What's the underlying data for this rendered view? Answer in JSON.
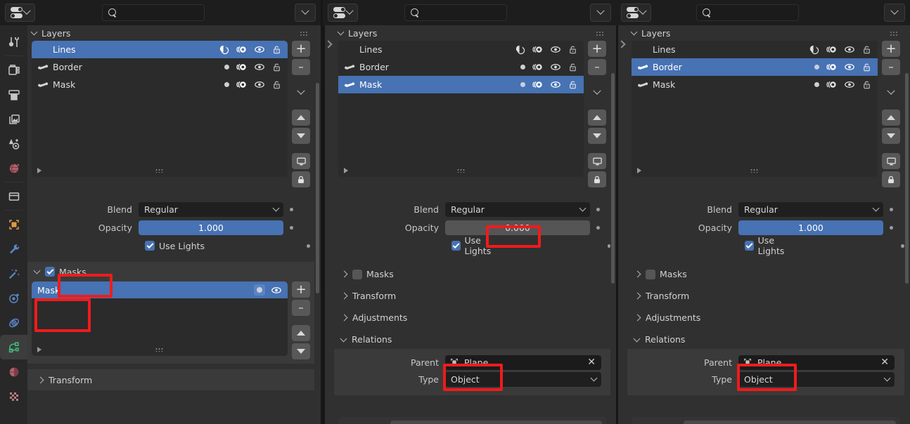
{
  "app": "Blender Properties Editor — Grease Pencil Layers",
  "header": {
    "editor_type_icon": "properties-editor-icon",
    "search_placeholder": "",
    "options_icon": "chevron-down-icon"
  },
  "sidebar_tabs": [
    {
      "name": "tool",
      "icon": "tool-icon",
      "selected": false
    },
    {
      "name": "render",
      "icon": "render-camera-icon",
      "selected": false
    },
    {
      "name": "output",
      "icon": "printer-output-icon",
      "selected": false
    },
    {
      "name": "view-layer",
      "icon": "images-viewlayer-icon",
      "selected": false
    },
    {
      "name": "scene",
      "icon": "scene-cone-droplet-icon",
      "selected": false
    },
    {
      "name": "world",
      "icon": "world-globe-icon",
      "selected": false
    },
    {
      "name": "collection",
      "icon": "collection-box-icon",
      "selected": false
    },
    {
      "name": "object",
      "icon": "object-square-icon",
      "selected": false
    },
    {
      "name": "modifiers",
      "icon": "wrench-icon",
      "selected": false
    },
    {
      "name": "effects",
      "icon": "magic-wand-icon",
      "selected": false
    },
    {
      "name": "particles",
      "icon": "particles-icon",
      "selected": false
    },
    {
      "name": "physics",
      "icon": "physics-orbit-icon",
      "selected": false
    },
    {
      "name": "object-data",
      "icon": "grease-pencil-data-icon",
      "selected": true
    },
    {
      "name": "material",
      "icon": "material-sphere-icon",
      "selected": false
    },
    {
      "name": "texture",
      "icon": "texture-checker-icon",
      "selected": false
    }
  ],
  "panels": [
    {
      "id": "panel-1",
      "layers_header": "Layers",
      "layers": [
        {
          "name": "Lines",
          "has_bone": false,
          "selected": true,
          "mask_dot": "filled-circle-icon",
          "onion": "onion-skin-icon",
          "visible": "eye-icon",
          "lock": "unlocked-icon"
        },
        {
          "name": "Border",
          "has_bone": true,
          "selected": false,
          "mask_dot": "dot-icon",
          "onion": "onion-skin-icon",
          "visible": "eye-icon",
          "lock": "unlocked-icon"
        },
        {
          "name": "Mask",
          "has_bone": true,
          "selected": false,
          "mask_dot": "dot-icon",
          "onion": "onion-skin-icon",
          "visible": "eye-icon",
          "lock": "unlocked-icon"
        }
      ],
      "list_buttons": [
        "add-icon",
        "remove-icon",
        "dropdown-icon",
        "move-up-icon",
        "move-down-icon",
        "isolate-display-icon",
        "lock-icon"
      ],
      "blend_label": "Blend",
      "blend_value": "Regular",
      "opacity_label": "Opacity",
      "opacity_value": "1.000",
      "opacity_filled": true,
      "use_lights_label": "Use Lights",
      "use_lights_checked": true,
      "masks_label": "Masks",
      "masks_checked": true,
      "masks_expanded": true,
      "mask_items": [
        {
          "name": "Mask",
          "selected": true,
          "invert": "invert-circle-icon",
          "visible": "eye-icon"
        }
      ],
      "transform_label": "Transform",
      "transform_expanded": false,
      "sections": [],
      "has_relations": false
    },
    {
      "id": "panel-2",
      "layers_header": "Layers",
      "layers": [
        {
          "name": "Lines",
          "has_bone": false,
          "selected": false,
          "mask_dot": "filled-circle-icon",
          "onion": "onion-skin-icon",
          "visible": "eye-icon",
          "lock": "unlocked-icon"
        },
        {
          "name": "Border",
          "has_bone": true,
          "selected": false,
          "mask_dot": "dot-icon",
          "onion": "onion-skin-icon",
          "visible": "eye-icon",
          "lock": "unlocked-icon"
        },
        {
          "name": "Mask",
          "has_bone": true,
          "selected": true,
          "mask_dot": "dot-icon",
          "onion": "onion-skin-icon",
          "visible": "eye-icon",
          "lock": "unlocked-icon"
        }
      ],
      "blend_label": "Blend",
      "blend_value": "Regular",
      "opacity_label": "Opacity",
      "opacity_value": "0.000",
      "opacity_filled": false,
      "use_lights_label": "Use Lights",
      "use_lights_checked": true,
      "masks_label": "Masks",
      "masks_checked": false,
      "masks_expanded": false,
      "sections": [
        {
          "label": "Transform",
          "expanded": false
        },
        {
          "label": "Adjustments",
          "expanded": false
        },
        {
          "label": "Relations",
          "expanded": true
        }
      ],
      "has_relations": true,
      "parent_label": "Parent",
      "parent_value": "Plane",
      "parent_icon": "object-plane-icon",
      "parent_clear_icon": "x-close-icon",
      "type_label": "Type",
      "type_value": "Object"
    },
    {
      "id": "panel-3",
      "layers_header": "Layers",
      "layers": [
        {
          "name": "Lines",
          "has_bone": false,
          "selected": false,
          "mask_dot": "filled-circle-icon",
          "onion": "onion-skin-icon",
          "visible": "eye-icon",
          "lock": "unlocked-icon"
        },
        {
          "name": "Border",
          "has_bone": true,
          "selected": true,
          "mask_dot": "dot-icon",
          "onion": "onion-skin-icon",
          "visible": "eye-icon",
          "lock": "unlocked-icon"
        },
        {
          "name": "Mask",
          "has_bone": true,
          "selected": false,
          "mask_dot": "dot-icon",
          "onion": "onion-skin-icon",
          "visible": "eye-icon",
          "lock": "unlocked-icon"
        }
      ],
      "blend_label": "Blend",
      "blend_value": "Regular",
      "opacity_label": "Opacity",
      "opacity_value": "1.000",
      "opacity_filled": true,
      "use_lights_label": "Use Lights",
      "use_lights_checked": true,
      "masks_label": "Masks",
      "masks_checked": false,
      "masks_expanded": false,
      "sections": [
        {
          "label": "Transform",
          "expanded": false
        },
        {
          "label": "Adjustments",
          "expanded": false
        },
        {
          "label": "Relations",
          "expanded": true
        }
      ],
      "has_relations": true,
      "parent_label": "Parent",
      "parent_value": "Plane",
      "parent_icon": "object-plane-icon",
      "parent_clear_icon": "x-close-icon",
      "type_label": "Type",
      "type_value": "Object"
    }
  ],
  "colors": {
    "accent_blue": "#4772b3",
    "panel_bg": "#303030",
    "list_bg": "#2b2b2b",
    "header_bg": "#1d1d1d",
    "annotation_red": "#f01b1b",
    "text": "#d2d2d2"
  },
  "annotations": [
    {
      "target": "panel-1 masks checkbox"
    },
    {
      "target": "panel-1 mask list item"
    },
    {
      "target": "panel-2 opacity value"
    },
    {
      "target": "panel-2 parent object"
    },
    {
      "target": "panel-3 parent object"
    }
  ]
}
